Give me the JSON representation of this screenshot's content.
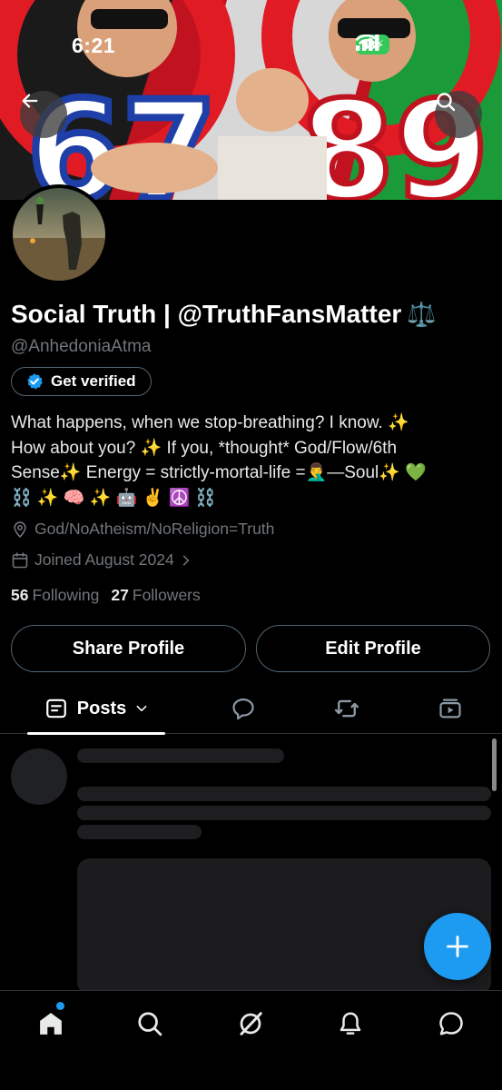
{
  "status_bar": {
    "time": "6:21",
    "battery": "98"
  },
  "profile": {
    "display_name": "Social Truth | @TruthFansMatter",
    "name_emoji": "⚖️",
    "handle": "@AnhedoniaAtma",
    "get_verified_label": "Get verified",
    "bio_line1": "What happens, when we stop-breathing? I know. ✨",
    "bio_line2": "How about you? ✨  If you, *thought* God/Flow/6th",
    "bio_line3": "Sense✨ Energy = strictly-mortal-life =🤦‍♂️—Soul✨ 💚",
    "bio_line4": "⛓️ ✨ 🧠 ✨ 🤖 ✌️ ☮️ ⛓️",
    "location": "God/NoAtheism/NoReligion=Truth",
    "joined": "Joined August 2024",
    "following_count": "56",
    "following_label": "Following",
    "followers_count": "27",
    "followers_label": "Followers"
  },
  "actions": {
    "share_label": "Share Profile",
    "edit_label": "Edit Profile"
  },
  "tabs": {
    "posts_label": "Posts"
  },
  "banner": {
    "numbers": [
      "67",
      "89"
    ]
  },
  "colors": {
    "accent": "#1d9bf0",
    "background": "#000000",
    "muted": "#71767b",
    "border": "#536471"
  }
}
